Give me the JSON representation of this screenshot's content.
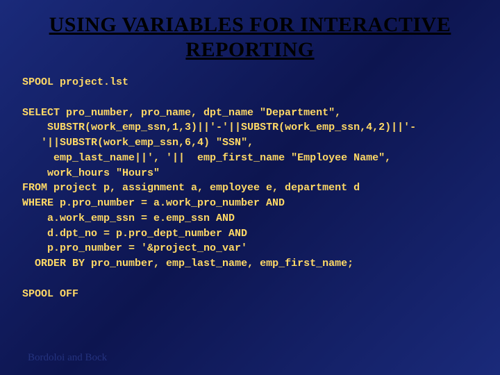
{
  "title": "USING VARIABLES FOR INTERACTIVE REPORTING",
  "code_lines": [
    "SPOOL project.lst",
    "",
    "SELECT pro_number, pro_name, dpt_name \"Department\",",
    "    SUBSTR(work_emp_ssn,1,3)||'-'||SUBSTR(work_emp_ssn,4,2)||'-",
    "   '||SUBSTR(work_emp_ssn,6,4) \"SSN\",",
    "     emp_last_name||', '||  emp_first_name \"Employee Name\",",
    "    work_hours \"Hours\"",
    "FROM project p, assignment a, employee e, department d",
    "WHERE p.pro_number = a.work_pro_number AND",
    "    a.work_emp_ssn = e.emp_ssn AND",
    "    d.dpt_no = p.pro_dept_number AND",
    "    p.pro_number = '&project_no_var'",
    "  ORDER BY pro_number, emp_last_name, emp_first_name;",
    "",
    "SPOOL OFF"
  ],
  "footer": "Bordoloi and Bock"
}
